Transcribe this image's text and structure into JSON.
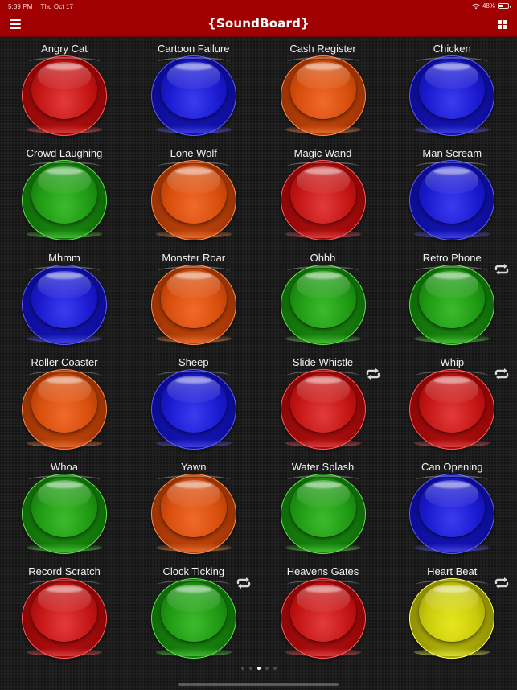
{
  "status_bar": {
    "time": "5:39 PM",
    "date": "Thu Oct 17",
    "battery_text": "48%",
    "battery_level": 0.48
  },
  "header": {
    "title": "{SoundBoard}",
    "menu_icon": "hamburger-menu-icon",
    "grid_icon": "grid-view-icon",
    "background_color": "#a10000"
  },
  "sounds": [
    {
      "label": "Angry Cat",
      "color": "red",
      "loop": false
    },
    {
      "label": "Cartoon Failure",
      "color": "blue",
      "loop": false
    },
    {
      "label": "Cash Register",
      "color": "orange",
      "loop": false
    },
    {
      "label": "Chicken",
      "color": "blue",
      "loop": false
    },
    {
      "label": "Crowd Laughing",
      "color": "green",
      "loop": false
    },
    {
      "label": "Lone Wolf",
      "color": "orange",
      "loop": false
    },
    {
      "label": "Magic Wand",
      "color": "red",
      "loop": false
    },
    {
      "label": "Man Scream",
      "color": "blue",
      "loop": false
    },
    {
      "label": "Mhmm",
      "color": "blue",
      "loop": false
    },
    {
      "label": "Monster Roar",
      "color": "orange",
      "loop": false
    },
    {
      "label": "Ohhh",
      "color": "green",
      "loop": false
    },
    {
      "label": "Retro Phone",
      "color": "green",
      "loop": true
    },
    {
      "label": "Roller Coaster",
      "color": "orange",
      "loop": false
    },
    {
      "label": "Sheep",
      "color": "blue",
      "loop": false
    },
    {
      "label": "Slide Whistle",
      "color": "red",
      "loop": true
    },
    {
      "label": "Whip",
      "color": "red",
      "loop": true
    },
    {
      "label": "Whoa",
      "color": "green",
      "loop": false
    },
    {
      "label": "Yawn",
      "color": "orange",
      "loop": false
    },
    {
      "label": "Water Splash",
      "color": "green",
      "loop": false
    },
    {
      "label": "Can Opening",
      "color": "blue",
      "loop": false
    },
    {
      "label": "Record Scratch",
      "color": "red",
      "loop": false
    },
    {
      "label": "Clock Ticking",
      "color": "green",
      "loop": true
    },
    {
      "label": "Heavens Gates",
      "color": "red",
      "loop": false
    },
    {
      "label": "Heart Beat",
      "color": "yellow",
      "loop": true
    }
  ],
  "loop_icon": "repeat-loop-icon",
  "pager": {
    "total_pages": 5,
    "current_page": 3
  }
}
